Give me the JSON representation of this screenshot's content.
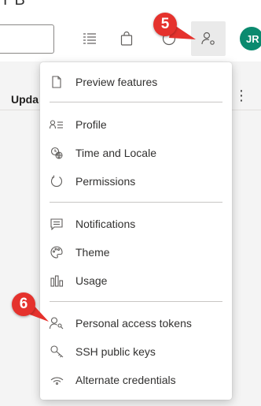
{
  "top_strip_text": "Y B",
  "avatar": {
    "initials": "JR",
    "color": "#0b8a6f"
  },
  "content": {
    "column_label": "Upda",
    "more_label": "⋮"
  },
  "menu": {
    "groups": [
      [
        {
          "label": "Preview features",
          "icon": "document-icon"
        }
      ],
      [
        {
          "label": "Profile",
          "icon": "profile-icon"
        },
        {
          "label": "Time and Locale",
          "icon": "globe-clock-icon"
        },
        {
          "label": "Permissions",
          "icon": "circle-arrow-icon"
        }
      ],
      [
        {
          "label": "Notifications",
          "icon": "chat-icon"
        },
        {
          "label": "Theme",
          "icon": "palette-icon"
        },
        {
          "label": "Usage",
          "icon": "chart-icon"
        }
      ],
      [
        {
          "label": "Personal access tokens",
          "icon": "user-key-icon"
        },
        {
          "label": "SSH public keys",
          "icon": "key-icon"
        },
        {
          "label": "Alternate credentials",
          "icon": "wifi-icon"
        }
      ]
    ]
  },
  "badges": {
    "step5": "5",
    "step6": "6",
    "color": "#e5322d"
  }
}
